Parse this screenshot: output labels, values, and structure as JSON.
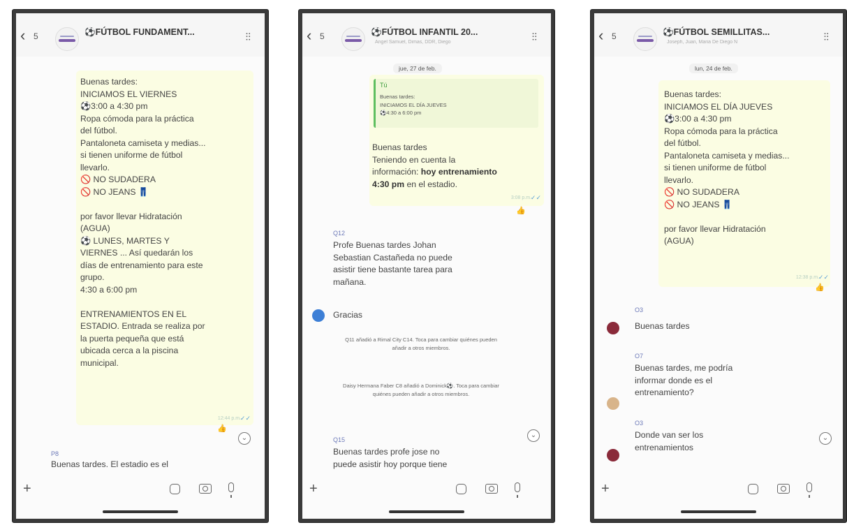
{
  "phones": [
    {
      "back_count": "5",
      "title": "⚽FÚTBOL FUNDAMENT...",
      "subtitle": "",
      "header_icon": "waveform-icon",
      "msg1": "Buenas tardes:\nINICIAMOS EL VIERNES\n⚽3:00 a 4:30 pm\nRopa cómoda para la práctica\ndel fútbol.\nPantaloneta camiseta y medias...\nsi tienen uniforme de fútbol\nllevarlo.\n🚫 NO SUDADERA\n🚫 NO JEANS 👖\n\npor favor llevar Hidratación\n(AGUA)\n⚽ LUNES, MARTES Y\nVIERNES ... Así quedarán los\ndías de entrenamiento para este\ngrupo.\n4:30 a 6:00 pm\n\nENTRENAMIENTOS EN EL\nESTADIO. Entrada se realiza por\nla puerta pequeña que está\nubicada cerca a la piscina\nmunicipal.",
      "reaction": "👍",
      "sender": "P8",
      "last_msg": "Buenas tardes. El estadio es el"
    },
    {
      "back_count": "5",
      "title": "⚽FÚTBOL INFANTIL 20...",
      "subtitle": "Angel Samuel, Dimas, DDR, Diego",
      "header_icon": "waveform-icon",
      "date": "jue, 27 de feb.",
      "quote_author": "Tú",
      "quote_text": "Buenas tardes:\nINICIAMOS EL DÍA JUEVES\n⚽4:30 a 6:00 pm",
      "reply_text_1": "Buenas tardes\nTeniendo en cuenta la\ninformación:",
      "reply_bold": "hoy entrenamiento\n4:30 pm",
      "reply_text_2": "en el estadio.",
      "reaction": "👍",
      "sender_1": "Q12",
      "msg_1": "Profe Buenas tardes Johan\nSebastian Castañeda no puede\nasistir tiene bastante tarea para\nmañana.",
      "msg_gracias": "Gracias",
      "sys_1": "Q11 añadió a Rimal City C14. Toca para\ncambiar quiénes pueden añadir a otros\nmiembros.",
      "sys_2": "Daisy Hermana Faber C8 añadió a\nDominick⚽. Toca para cambiar quiénes\npueden añadir a otros miembros.",
      "sender_2": "Q15",
      "msg_2": "Buenas tardes profe jose no\npuede asistir hoy porque tiene"
    },
    {
      "back_count": "5",
      "title": "⚽FÚTBOL SEMILLITAS...",
      "subtitle": "Joseph, Juan, Maria De Diego N",
      "header_icon": "waveform-icon",
      "date": "lun, 24 de feb.",
      "msg1": "Buenas tardes:\nINICIAMOS EL DÍA JUEVES\n⚽3:00 a 4:30 pm\nRopa cómoda para la práctica\ndel fútbol.\nPantaloneta camiseta y medias...\nsi tienen uniforme de fútbol\nllevarlo.\n🚫 NO SUDADERA\n🚫 NO JEANS 👖\n\npor favor llevar Hidratación\n(AGUA)",
      "reaction": "👍",
      "sender_1": "O3",
      "msg_a": "Buenas tardes",
      "sender_2": "O7",
      "msg_b": "Buenas tardes, me podría\ninformar donde es el\nentrenamiento?",
      "sender_3": "O3",
      "msg_c": "Donde van ser los\nentrenamientos"
    }
  ],
  "colors": {
    "bubble_out": "#fbfde3",
    "sender_name": "#6c79b8",
    "read_tick": "#5a9fd5"
  }
}
